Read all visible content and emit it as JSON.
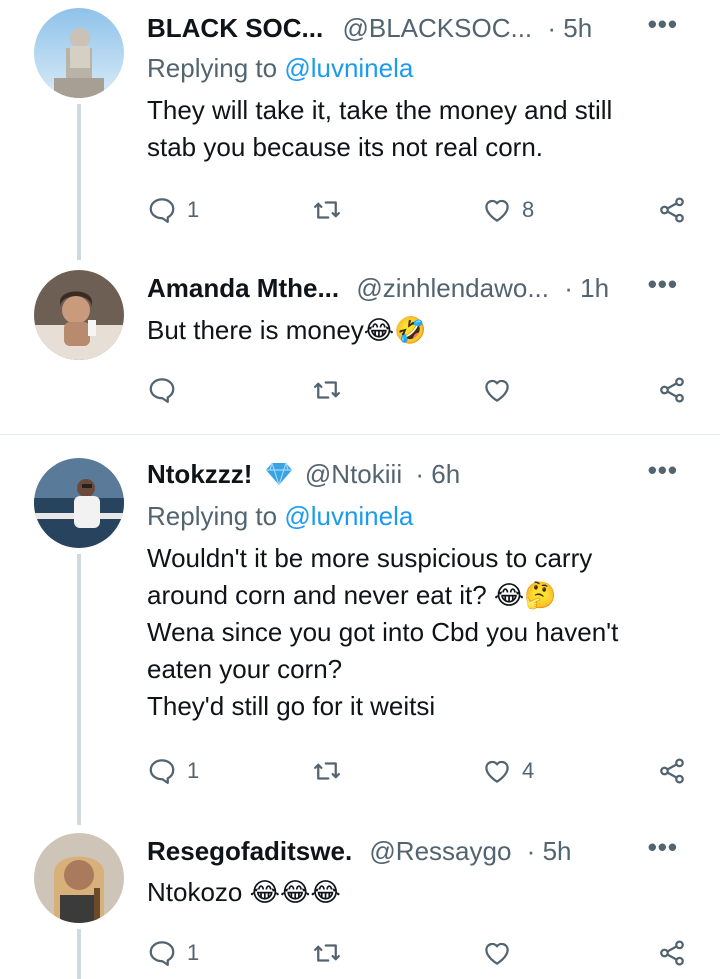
{
  "tweets": [
    {
      "name": "BLACK SOC...",
      "handle": "@BLACKSOC...",
      "time": "5h",
      "replying_prefix": "Replying to ",
      "replying_to": "@luvninela",
      "lines": [
        "They will take it, take the money and still",
        "stab you because its not real corn."
      ],
      "reply_count": "1",
      "retweet_count": "",
      "like_count": "8"
    },
    {
      "name": "Amanda Mthe...",
      "handle": "@zinhlendawo...",
      "time": "1h",
      "lines": [
        "But there is money😂🤣"
      ],
      "reply_count": "",
      "retweet_count": "",
      "like_count": ""
    },
    {
      "name": "Ntokzzz!",
      "handle": "@Ntokiii",
      "time": "6h",
      "replying_prefix": "Replying to ",
      "replying_to": "@luvninela",
      "lines": [
        "Wouldn't it be more suspicious to carry",
        "around corn and never eat it? 😂🤔",
        "Wena since you got into Cbd you haven't",
        "eaten your corn?",
        "They'd still go for it weitsi"
      ],
      "reply_count": "1",
      "retweet_count": "",
      "like_count": "4"
    },
    {
      "name": "Resegofaditswe.",
      "handle": "@Ressaygo",
      "time": "5h",
      "lines": [
        "Ntokozo 😂😂😂"
      ],
      "reply_count": "1",
      "retweet_count": "",
      "like_count": ""
    }
  ],
  "separator_dot": "·",
  "more_label": "•••",
  "colors": {
    "text": "#0f1419",
    "muted": "#536471",
    "link": "#1d9bf0",
    "thread": "#cfd9de",
    "verified": "#3aa3e3"
  },
  "icons": [
    "reply-icon",
    "retweet-icon",
    "like-icon",
    "share-icon",
    "more-icon",
    "verified-icon"
  ]
}
